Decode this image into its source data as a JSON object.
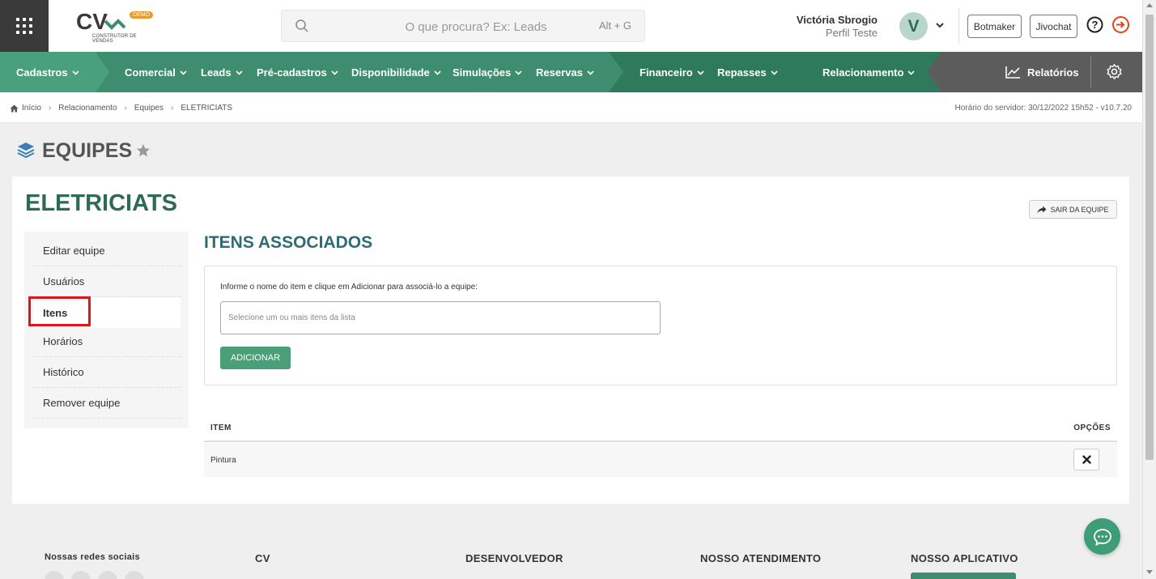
{
  "header": {
    "logo_text": "CV",
    "logo_badge": "DEMO",
    "logo_subtitle": "CONSTRUTOR DE VENDAS",
    "search_placeholder": "O que procura? Ex: Leads",
    "search_shortcut": "Alt + G",
    "user_name": "Victória Sbrogio",
    "user_profile": "Perfil Teste",
    "avatar_letter": "V",
    "botmaker_label": "Botmaker",
    "jivochat_label": "Jivochat"
  },
  "nav": {
    "items": [
      {
        "label": "Cadastros"
      },
      {
        "label": "Comercial"
      },
      {
        "label": "Leads"
      },
      {
        "label": "Pré-cadastros"
      },
      {
        "label": "Disponibilidade"
      },
      {
        "label": "Simulações"
      },
      {
        "label": "Reservas"
      },
      {
        "label": "Financeiro"
      },
      {
        "label": "Repasses"
      },
      {
        "label": "Relacionamento"
      }
    ],
    "reports_label": "Relatórios",
    "colors": {
      "primary": "#3f8d70",
      "dark": "#2f7a5c",
      "reports_bg": "#5c5c5c"
    }
  },
  "breadcrumb": {
    "items": [
      "Início",
      "Relacionamento",
      "Equipes",
      "ELETRICIATS"
    ],
    "server_time": "Horário do servidor: 30/12/2022 15h52 - v10.7.20"
  },
  "page": {
    "title": "EQUIPES"
  },
  "team": {
    "name": "ELETRICIATS",
    "leave_label": "SAIR DA EQUIPE",
    "menu": [
      {
        "label": "Editar equipe"
      },
      {
        "label": "Usuários"
      },
      {
        "label": "Itens"
      },
      {
        "label": "Horários"
      },
      {
        "label": "Histórico"
      },
      {
        "label": "Remover equipe"
      }
    ],
    "active_menu": "Itens"
  },
  "items_section": {
    "title": "ITENS ASSOCIADOS",
    "hint": "Informe o nome do item e clique em Adicionar para associá-lo a equipe:",
    "select_placeholder": "Selecione um ou mais itens da lista",
    "add_label": "ADICIONAR",
    "table": {
      "columns": [
        "ITEM",
        "OPÇÕES"
      ],
      "rows": [
        {
          "item": "Pintura"
        }
      ]
    }
  },
  "footer": {
    "social_title": "Nossas redes sociais",
    "cv_title": "CV",
    "dev_title": "DESENVOLVEDOR",
    "support_title": "NOSSO ATENDIMENTO",
    "app_title": "NOSSO APLICATIVO"
  }
}
